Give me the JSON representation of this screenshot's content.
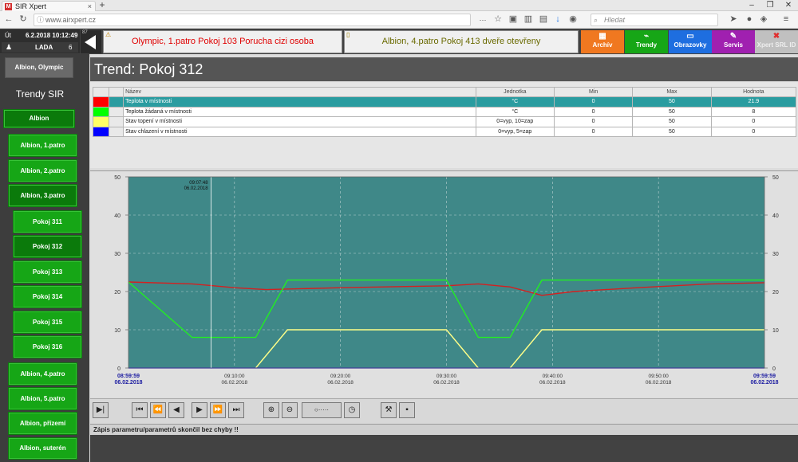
{
  "browser": {
    "tab_title": "SIR Xpert",
    "url": "www.airxpert.cz",
    "search_placeholder": "Hledat"
  },
  "header": {
    "day": "Út",
    "datetime": "6.2.2018 10:12:49",
    "user": "LADA",
    "user_level": "6",
    "back_badge": "87",
    "alarm1": "Olympic, 1.patro Pokoj 103 Porucha cizi osoba",
    "alarm2": "Albion, 4.patro Pokoj 413 dveře otevřeny",
    "btn_archiv": "Archív",
    "btn_trendy": "Trendy",
    "btn_obrazovky": "Obrazovky",
    "btn_servis": "Servis",
    "btn_xpert": "Xpert SRL ID"
  },
  "colors": {
    "archiv": "#f07820",
    "trendy": "#16a616",
    "obrazovky": "#1e6ee0",
    "servis": "#a020b0",
    "xpert": "#c0c0c0",
    "alarm1_text": "#e00000",
    "alarm2_text": "#6a6a00"
  },
  "sidebar": {
    "top_button": "Albion, Olympic",
    "section_title": "Trendy SIR",
    "items": [
      {
        "label": "Albion",
        "selected": true
      },
      {
        "label": "Albion, 1.patro"
      },
      {
        "label": "Albion, 2.patro"
      },
      {
        "label": "Albion, 3.patro",
        "selected": true
      },
      {
        "label": "Pokoj 311"
      },
      {
        "label": "Pokoj 312",
        "selected": true
      },
      {
        "label": "Pokoj 313"
      },
      {
        "label": "Pokoj 314"
      },
      {
        "label": "Pokoj 315"
      },
      {
        "label": "Pokoj 316"
      },
      {
        "label": "Albion, 4.patro"
      },
      {
        "label": "Albion, 5.patro"
      },
      {
        "label": "Albion, přízemí"
      },
      {
        "label": "Albion, suterén"
      }
    ]
  },
  "page_title": "Trend: Pokoj 312",
  "legend_table": {
    "headers": [
      "Název",
      "Jednotka",
      "Min",
      "Max",
      "Hodnota"
    ],
    "rows": [
      {
        "color": "#ff0000",
        "name": "Teplota v místnosti",
        "unit": "°C",
        "min": "0",
        "max": "50",
        "value": "21.9",
        "highlight": true
      },
      {
        "color": "#00ff00",
        "name": "Teplota žádaná v místnosti",
        "unit": "°C",
        "min": "0",
        "max": "50",
        "value": "8"
      },
      {
        "color": "#ffff66",
        "name": "Stav topení v místnosti",
        "unit": "0=vyp, 10=zap",
        "min": "0",
        "max": "50",
        "value": "0"
      },
      {
        "color": "#0000ff",
        "name": "Stav chlazení v místnosti",
        "unit": "0=vyp, 5=zap",
        "min": "0",
        "max": "50",
        "value": "0"
      }
    ]
  },
  "chart_data": {
    "type": "line",
    "ylim": [
      0,
      50
    ],
    "yticks": [
      "0",
      "10",
      "20",
      "30",
      "40",
      "50"
    ],
    "xlim_minutes": [
      0,
      60
    ],
    "start_label": {
      "time": "08:59:59",
      "date": "06.02.2018"
    },
    "end_label": {
      "time": "09:59:59",
      "date": "06.02.2018"
    },
    "xticks": [
      {
        "t": 10,
        "time": "09:10:00",
        "date": "06.02.2018"
      },
      {
        "t": 20,
        "time": "09:20:00",
        "date": "06.02.2018"
      },
      {
        "t": 30,
        "time": "09:30:00",
        "date": "06.02.2018"
      },
      {
        "t": 40,
        "time": "09:40:00",
        "date": "06.02.2018"
      },
      {
        "t": 50,
        "time": "09:50:00",
        "date": "06.02.2018"
      }
    ],
    "cursor": {
      "t": 7.8,
      "time": "09:07:48",
      "date": "06.02.2018"
    },
    "series": [
      {
        "name": "Teplota v místnosti",
        "color": "#d42020",
        "points": [
          [
            0,
            22.5
          ],
          [
            6,
            22
          ],
          [
            10,
            21
          ],
          [
            13,
            20.5
          ],
          [
            20,
            21
          ],
          [
            30,
            21.5
          ],
          [
            33,
            22
          ],
          [
            36,
            21.2
          ],
          [
            39,
            19
          ],
          [
            42,
            20
          ],
          [
            48,
            21
          ],
          [
            55,
            22
          ],
          [
            60,
            22.3
          ]
        ]
      },
      {
        "name": "Teplota žádaná v místnosti",
        "color": "#22ee22",
        "points": [
          [
            0,
            22.5
          ],
          [
            6,
            8
          ],
          [
            12,
            8
          ],
          [
            15,
            23
          ],
          [
            30,
            23
          ],
          [
            33,
            8
          ],
          [
            36,
            8
          ],
          [
            39,
            23
          ],
          [
            60,
            23
          ]
        ]
      },
      {
        "name": "Stav topení v místnosti",
        "color": "#ffff88",
        "points": [
          [
            12,
            0
          ],
          [
            15,
            10
          ],
          [
            30,
            10
          ],
          [
            33,
            0
          ]
        ]
      },
      {
        "name": "Stav topení v místnosti (2)",
        "color": "#ffff88",
        "points": [
          [
            36,
            0
          ],
          [
            39,
            10
          ],
          [
            60,
            10
          ]
        ]
      }
    ]
  },
  "status_message": "Zápis parametru/parametrů skončil bez chyby !!"
}
